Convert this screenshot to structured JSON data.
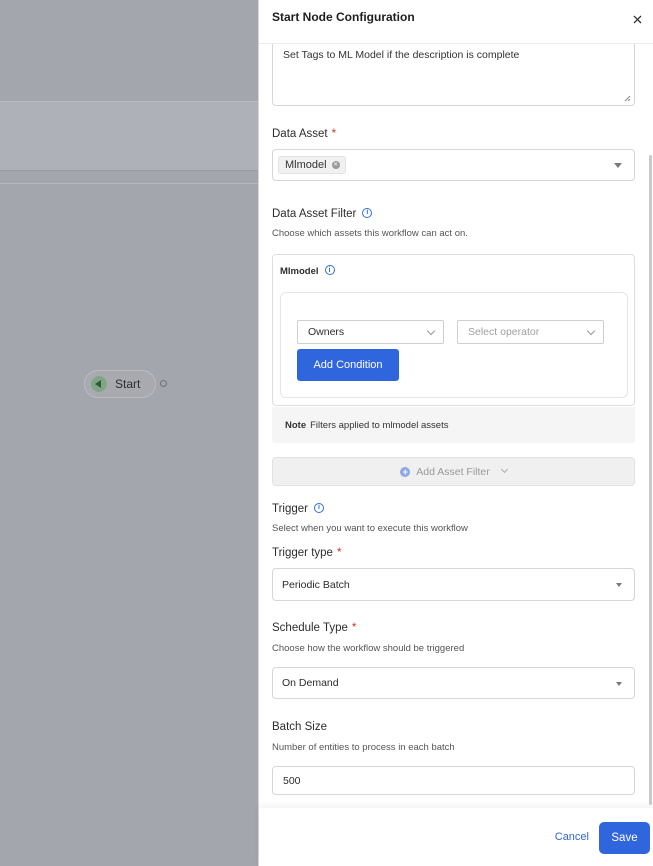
{
  "canvas": {
    "start_node_label": "Start"
  },
  "drawer": {
    "title": "Start Node Configuration",
    "description_value": "Set Tags to ML Model if the description is complete",
    "data_asset": {
      "label": "Data Asset",
      "required": "*",
      "selected_tag": "Mlmodel"
    },
    "data_asset_filter": {
      "label": "Data Asset Filter",
      "helper": "Choose which assets this workflow can act on.",
      "card_title": "Mlmodel",
      "field_select": "Owners",
      "operator_placeholder": "Select operator",
      "add_condition_label": "Add Condition",
      "note_prefix": "Note",
      "note_text": "Filters applied to mlmodel assets",
      "add_asset_filter_label": "Add Asset Filter"
    },
    "trigger": {
      "label": "Trigger",
      "helper": "Select when you want to execute this workflow",
      "type_label": "Trigger type",
      "required": "*",
      "type_value": "Periodic Batch"
    },
    "schedule": {
      "label": "Schedule Type",
      "required": "*",
      "helper": "Choose how the workflow should be triggered",
      "value": "On Demand"
    },
    "batch": {
      "label": "Batch Size",
      "helper": "Number of entities to process in each batch",
      "value": "500"
    },
    "footer": {
      "cancel_label": "Cancel",
      "save_label": "Save"
    }
  },
  "colors": {
    "primary": "#2f65dd",
    "required": "#d0342c",
    "start_node_dot": "#7fa786"
  }
}
